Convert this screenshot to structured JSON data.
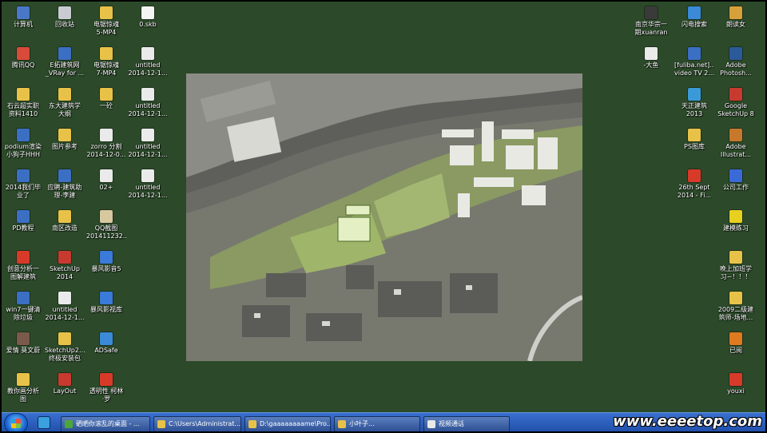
{
  "desktop": {
    "icons_left": [
      {
        "label": "计算机",
        "color": "#4a78c8",
        "icon": "computer-icon"
      },
      {
        "label": "回收站",
        "color": "#c8ccd2",
        "icon": "recycle-bin-icon"
      },
      {
        "label": "电锯惊魂\n5-MP4",
        "color": "#e8c248",
        "icon": "folder-icon"
      },
      {
        "label": "0.skb",
        "color": "#f4f4f4",
        "icon": "file-icon"
      },
      {
        "label": "腾讯QQ",
        "color": "#d94a3a",
        "icon": "qq-icon"
      },
      {
        "label": "E拓建筑网\n_VRay for ...",
        "color": "#3b6fc4",
        "icon": "web-icon"
      },
      {
        "label": "电锯惊魂\n7-MP4",
        "color": "#e8c248",
        "icon": "folder-icon"
      },
      {
        "label": "untitled\n2014-12-1...",
        "color": "#eaeaea",
        "icon": "image-icon"
      },
      {
        "label": "石云超实职\n资料1410",
        "color": "#e8c248",
        "icon": "folder-icon"
      },
      {
        "label": "东大建筑学\n大纲",
        "color": "#e8c248",
        "icon": "folder-icon"
      },
      {
        "label": "一砼",
        "color": "#e8c248",
        "icon": "folder-icon"
      },
      {
        "label": "untitled\n2014-12-1...",
        "color": "#eaeaea",
        "icon": "image-icon"
      },
      {
        "label": "podium渲染\n小狗子HHH",
        "color": "#3b6fc4",
        "icon": "document-icon"
      },
      {
        "label": "图片参考",
        "color": "#e8c248",
        "icon": "folder-icon"
      },
      {
        "label": "zorro 分割\n2014-12-0...",
        "color": "#eaeaea",
        "icon": "image-icon"
      },
      {
        "label": "untitled\n2014-12-1...",
        "color": "#eaeaea",
        "icon": "image-icon"
      },
      {
        "label": "2014我们毕\n业了",
        "color": "#3b6fc4",
        "icon": "document-icon"
      },
      {
        "label": "应聘-建筑助\n理-李建",
        "color": "#3b6fc4",
        "icon": "document-icon"
      },
      {
        "label": "02+",
        "color": "#eaeaea",
        "icon": "image-icon"
      },
      {
        "label": "untitled\n2014-12-1...",
        "color": "#eaeaea",
        "icon": "image-icon"
      },
      {
        "label": "PD教程",
        "color": "#3b6fc4",
        "icon": "document-icon"
      },
      {
        "label": "南区改造",
        "color": "#e8c248",
        "icon": "folder-icon"
      },
      {
        "label": "QQ截图\n201411232...",
        "color": "#d8c8a0",
        "icon": "image-icon"
      },
      {
        "label": "",
        "color": "",
        "icon": ""
      },
      {
        "label": "创意分析一\n图解建筑",
        "color": "#d83a2a",
        "icon": "pdf-icon"
      },
      {
        "label": "SketchUp\n2014",
        "color": "#c83a30",
        "icon": "sketchup-icon"
      },
      {
        "label": "暴风影音5",
        "color": "#3a7ad8",
        "icon": "player-icon"
      },
      {
        "label": "",
        "color": "",
        "icon": ""
      },
      {
        "label": "win7一键清\n除垃圾",
        "color": "#3b6fc4",
        "icon": "document-icon"
      },
      {
        "label": "untitled\n2014-12-1...",
        "color": "#eaeaea",
        "icon": "image-icon"
      },
      {
        "label": "暴风影视库",
        "color": "#3a7ad8",
        "icon": "player-icon"
      },
      {
        "label": "",
        "color": "",
        "icon": ""
      },
      {
        "label": "爱情 莫文蔚",
        "color": "#7a5a4a",
        "icon": "music-icon"
      },
      {
        "label": "SketchUp2...\n终极安装包",
        "color": "#e8c248",
        "icon": "folder-icon"
      },
      {
        "label": "ADSafe",
        "color": "#3b8ad8",
        "icon": "adsafe-icon"
      },
      {
        "label": "",
        "color": "",
        "icon": ""
      },
      {
        "label": "教你画分析\n图",
        "color": "#e8c248",
        "icon": "folder-icon"
      },
      {
        "label": "LayOut",
        "color": "#c83a30",
        "icon": "layout-icon"
      },
      {
        "label": "透明性 柯林\n·罗",
        "color": "#d83a2a",
        "icon": "pdf-icon"
      },
      {
        "label": "",
        "color": "",
        "icon": ""
      }
    ],
    "icons_right": [
      {
        "label": "南京华宗一\n期xuanran",
        "color": "#3a3a3a",
        "icon": "film-icon"
      },
      {
        "label": "闪电搜索",
        "color": "#3a8ad8",
        "icon": "search-icon"
      },
      {
        "label": "朗读女",
        "color": "#d8a03a",
        "icon": "reader-icon"
      },
      {
        "label": "-大鱼",
        "color": "#eaeaea",
        "icon": "image-icon"
      },
      {
        "label": "[fuliba.net]...\nvideo TV 2...",
        "color": "#3b6fc4",
        "icon": "video-icon"
      },
      {
        "label": "Adobe\nPhotosh...",
        "color": "#2a5a9a",
        "icon": "photoshop-icon"
      },
      {
        "label": "天正建筑\n2013",
        "color": "#3a9ad8",
        "icon": "tangent-icon"
      },
      {
        "label": "Google\nSketchUp 8",
        "color": "#c83a30",
        "icon": "sketchup-icon"
      },
      {
        "label": "PS图库",
        "color": "#e8c248",
        "icon": "folder-icon"
      },
      {
        "label": "Adobe\nIllustrat...",
        "color": "#c8782a",
        "icon": "illustrator-icon"
      },
      {
        "label": "26th Sept\n2014 - Fi...",
        "color": "#d83a2a",
        "icon": "pdf-icon"
      },
      {
        "label": "公司工作",
        "color": "#3a6ad8",
        "icon": "help-icon"
      },
      {
        "label": "建模练习",
        "color": "#e8d020",
        "icon": "star-icon"
      },
      {
        "label": "晚上加班学\n习~！！！",
        "color": "#e8c248",
        "icon": "folder-icon"
      },
      {
        "label": "2009二级建\n筑师-场地...",
        "color": "#e8c248",
        "icon": "folder-icon"
      },
      {
        "label": "已阅",
        "color": "#e07a20",
        "icon": "check-icon"
      },
      {
        "label": "youxi",
        "color": "#d83a2a",
        "icon": "game-icon"
      }
    ]
  },
  "taskbar": {
    "buttons": [
      {
        "label": "硒晒你滚乱的桌面 - ...",
        "color": "#4aa83a",
        "icon": "browser-icon"
      },
      {
        "label": "C:\\Users\\Administrat...",
        "color": "#e8c248",
        "icon": "explorer-icon"
      },
      {
        "label": "D:\\gaaaaaaaame\\Pro...",
        "color": "#e8c248",
        "icon": "explorer-icon"
      },
      {
        "label": "小叶子...",
        "color": "#e8c248",
        "icon": "folder-icon"
      },
      {
        "label": "视频通话",
        "color": "#e8e8e8",
        "icon": "video-call-icon"
      }
    ]
  },
  "watermark": "www.eeeetop.com"
}
